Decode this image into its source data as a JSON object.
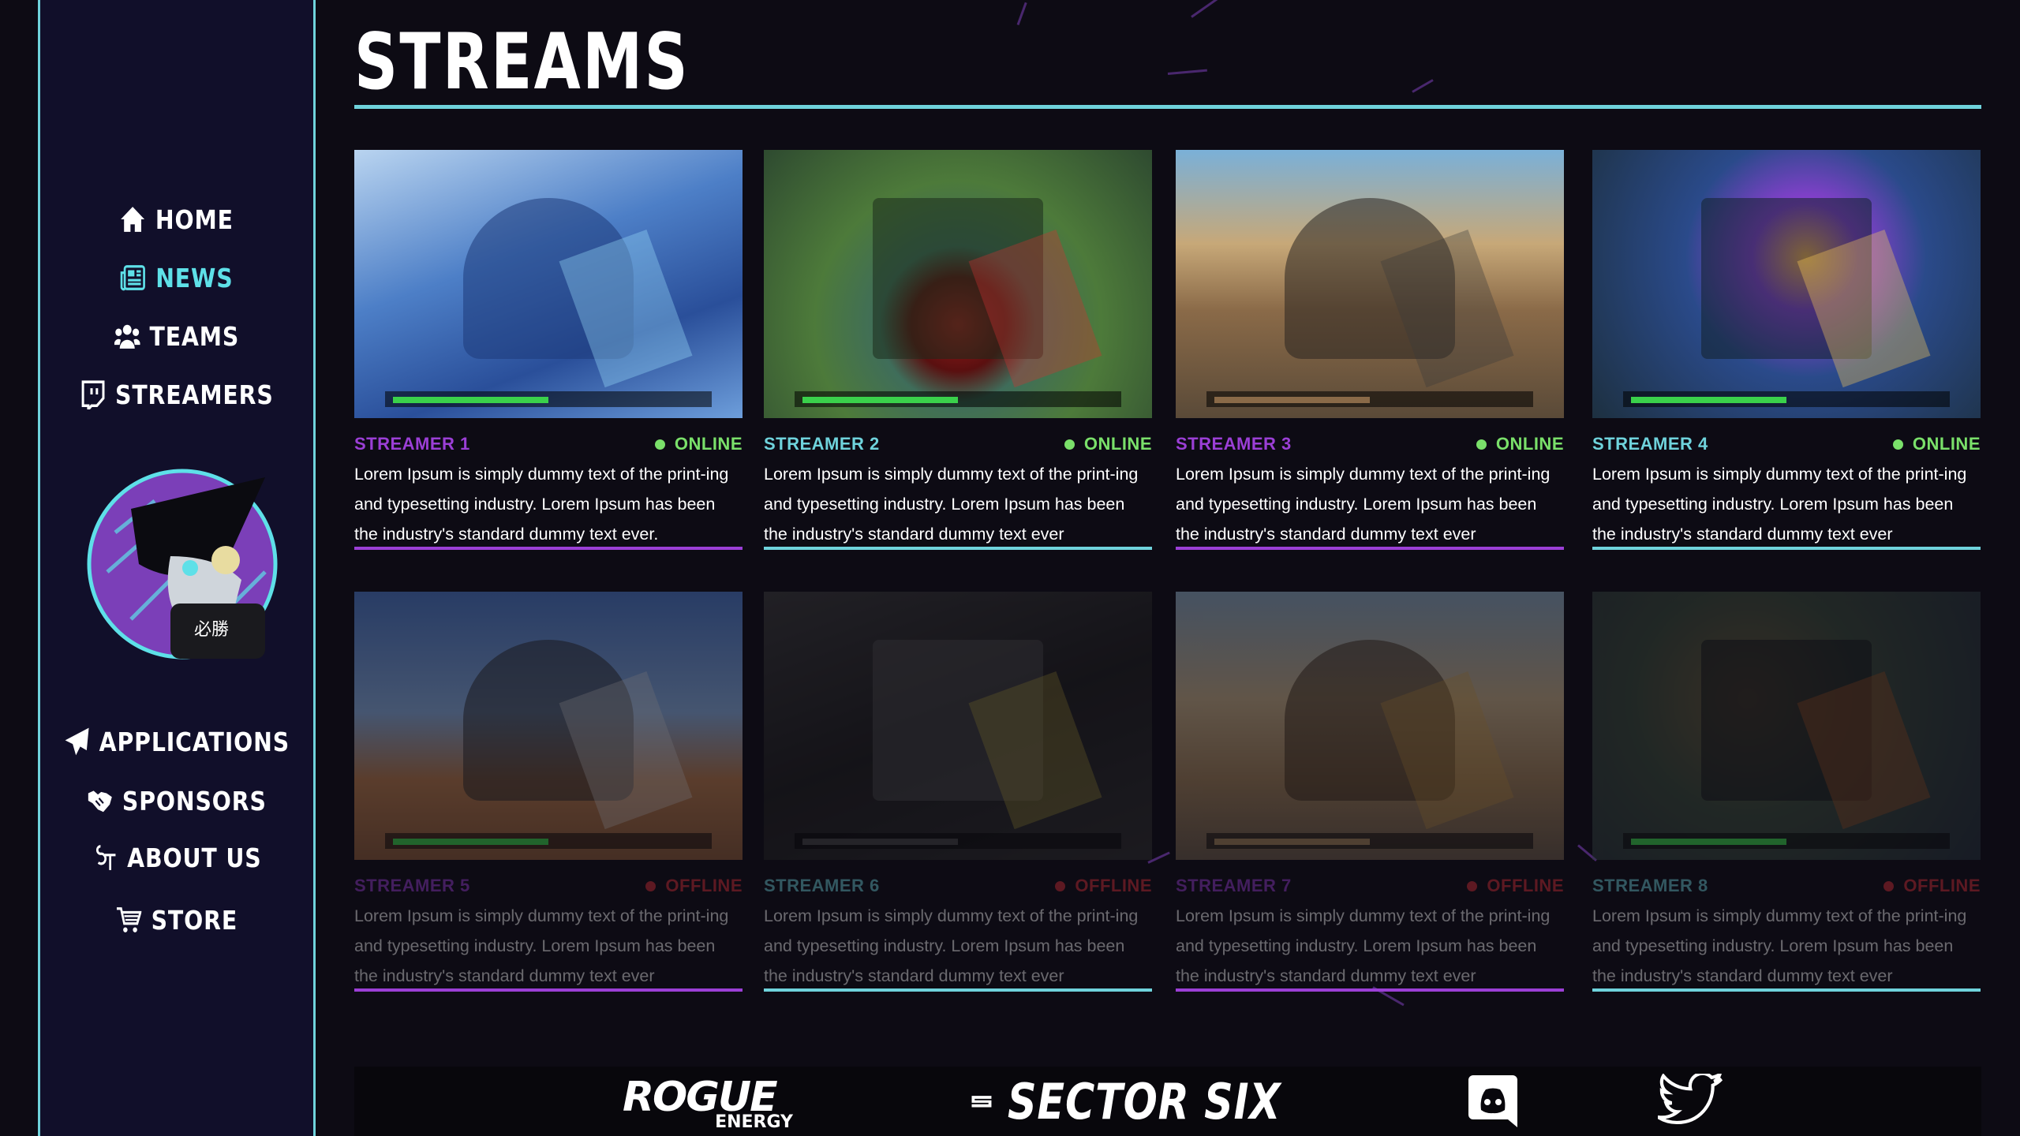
{
  "colors": {
    "accent_cyan": "#6fd3dc",
    "accent_purple": "#9b3fd6",
    "online_green": "#7ae06a",
    "offline_red": "#e0303a",
    "sidebar_bg": "#110f2a"
  },
  "sidebar": {
    "nav_top": [
      {
        "label": "HOME",
        "icon": "home-icon",
        "active": false
      },
      {
        "label": "NEWS",
        "icon": "newspaper-icon",
        "active": true
      },
      {
        "label": "TEAMS",
        "icon": "users-icon",
        "active": false
      },
      {
        "label": "STREAMERS",
        "icon": "twitch-icon",
        "active": false
      }
    ],
    "avatar_badge_text": "必勝",
    "nav_bottom": [
      {
        "label": "APPLICATIONS",
        "icon": "paper-plane-icon"
      },
      {
        "label": "SPONSORS",
        "icon": "handshake-icon"
      },
      {
        "label": "ABOUT US",
        "icon": "team-logo-icon"
      },
      {
        "label": "STORE",
        "icon": "shopping-cart-icon"
      }
    ]
  },
  "page": {
    "title": "STREAMS"
  },
  "streams": [
    {
      "name": "STREAMER 1",
      "status": "ONLINE",
      "name_color": "#9b3fd6",
      "description": "Lorem Ipsum is simply dummy text of the print-ing and typesetting industry. Lorem Ipsum has been the industry's standard dummy text ever."
    },
    {
      "name": "STREAMER 2",
      "status": "ONLINE",
      "name_color": "#6fd3dc",
      "description": "Lorem Ipsum is simply dummy text of the print-ing and typesetting industry. Lorem Ipsum has been the industry's standard dummy text ever"
    },
    {
      "name": "STREAMER 3",
      "status": "ONLINE",
      "name_color": "#9b3fd6",
      "description": "Lorem Ipsum is simply dummy text of the print-ing and typesetting industry. Lorem Ipsum has been the industry's standard dummy text ever"
    },
    {
      "name": "STREAMER 4",
      "status": "ONLINE",
      "name_color": "#6fd3dc",
      "description": "Lorem Ipsum is simply dummy text of the print-ing and typesetting industry. Lorem Ipsum has been the industry's standard dummy text ever"
    },
    {
      "name": "STREAMER 5",
      "status": "OFFLINE",
      "name_color": "#9b3fd6",
      "description": "Lorem Ipsum is simply dummy text of the print-ing and typesetting industry. Lorem Ipsum has been the industry's standard dummy text ever"
    },
    {
      "name": "STREAMER 6",
      "status": "OFFLINE",
      "name_color": "#6fd3dc",
      "description": "Lorem Ipsum is simply dummy text of the print-ing and typesetting industry. Lorem Ipsum has been the industry's standard dummy text ever"
    },
    {
      "name": "STREAMER 7",
      "status": "OFFLINE",
      "name_color": "#9b3fd6",
      "description": "Lorem Ipsum is simply dummy text of the print-ing and typesetting industry. Lorem Ipsum has been the industry's standard dummy text ever"
    },
    {
      "name": "STREAMER 8",
      "status": "OFFLINE",
      "name_color": "#6fd3dc",
      "description": "Lorem Ipsum is simply dummy text of the print-ing and typesetting industry. Lorem Ipsum has been the industry's standard dummy text ever"
    }
  ],
  "footer": {
    "sponsor_1_main": "ROGUE",
    "sponsor_1_sub": "ENERGY",
    "sponsor_2": "SECTOR SIX",
    "discord_icon": "discord-icon",
    "twitter_icon": "twitter-icon"
  }
}
